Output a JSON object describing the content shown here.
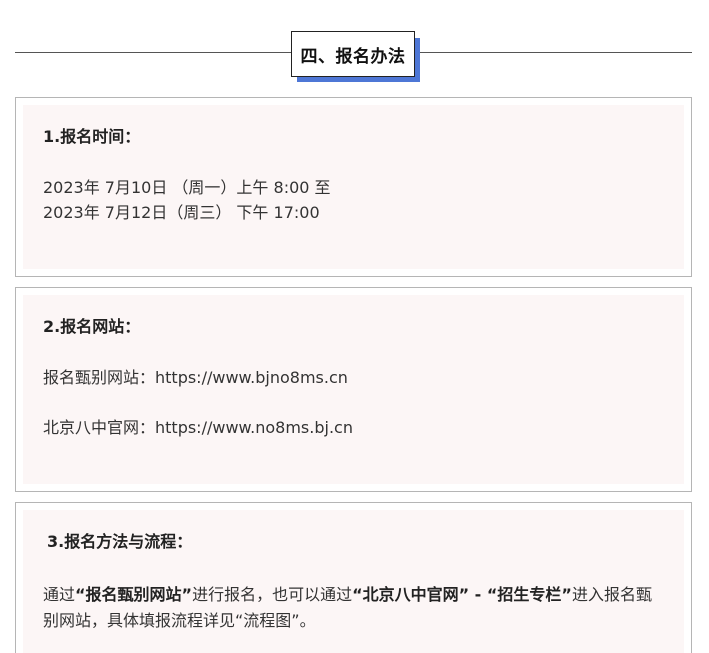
{
  "section_header": {
    "title": "四、报名办法"
  },
  "card1": {
    "heading": "1.报名时间：",
    "line1": "2023年 7月10日 （周一）上午 8:00 至",
    "line2": "2023年 7月12日（周三） 下午 17:00"
  },
  "card2": {
    "heading": "2.报名网站：",
    "line1": "报名甄别网站：https://www.bjno8ms.cn",
    "line2": "北京八中官网：https://www.no8ms.bj.cn"
  },
  "card3": {
    "heading": "3.报名方法与流程：",
    "para": {
      "t1": "通过",
      "b1": "“报名甄别网站”",
      "t2": "进行报名，也可以通过",
      "b2": "“北京八中官网” - “招生专栏”",
      "t3": "进入报名甄别网站，具体填报流程详见“流程图”。"
    }
  },
  "colors": {
    "accent_shadow": "#4e77d6",
    "card_bg": "#fcf6f6",
    "card_border": "#b5b5b5"
  }
}
